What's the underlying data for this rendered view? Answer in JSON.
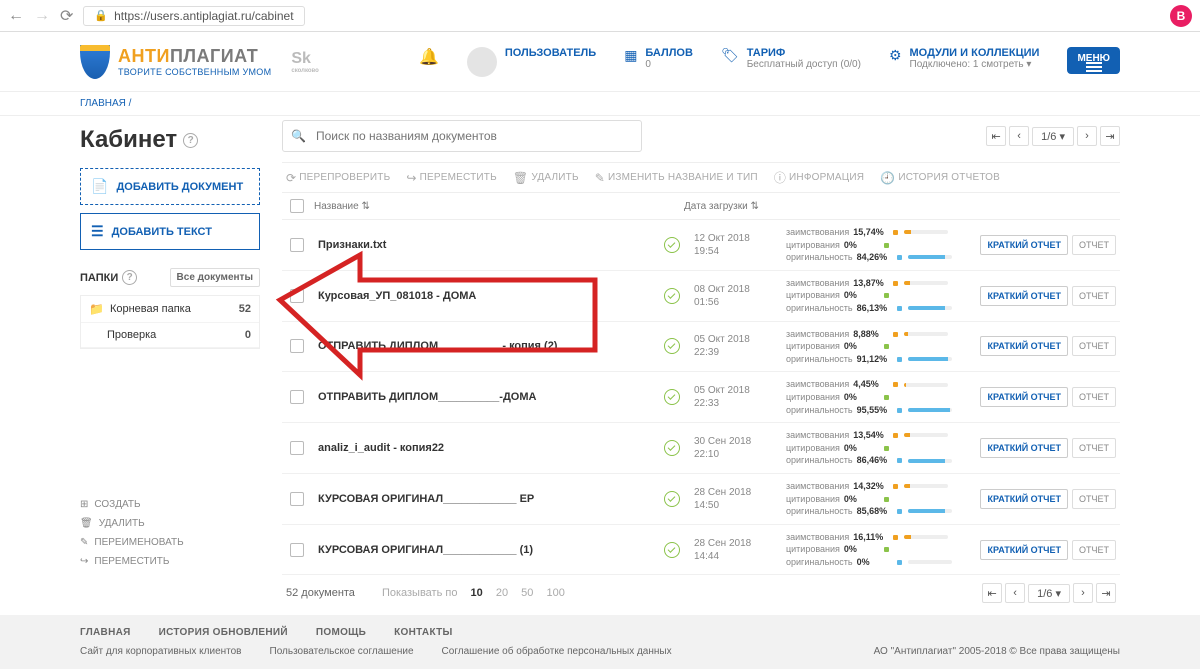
{
  "browser": {
    "url": "https://users.antiplagiat.ru/cabinet",
    "user_initial": "B"
  },
  "header": {
    "logo_anti": "АНТИ",
    "logo_plag": "ПЛАГИАТ",
    "logo_sub": "ТВОРИТЕ СОБСТВЕННЫМ УМОМ",
    "sk": "Sk",
    "sk_sub": "сколково",
    "user_label": "ПОЛЬЗОВАТЕЛЬ",
    "ballov_label": "БАЛЛОВ",
    "ballov_value": "0",
    "tarif_label": "ТАРИФ",
    "tarif_value": "Бесплатный доступ (0/0)",
    "modules_label": "МОДУЛИ И КОЛЛЕКЦИИ",
    "modules_value": "Подключено: 1 смотреть ▾",
    "menu_label": "МЕНЮ"
  },
  "crumb": "ГЛАВНАЯ /",
  "sidebar": {
    "title": "Кабинет",
    "add_doc": "ДОБАВИТЬ ДОКУМЕНТ",
    "add_text": "ДОБАВИТЬ ТЕКСТ",
    "folders_label": "ПАПКИ",
    "all_docs": "Все документы",
    "root": {
      "label": "Корневая папка",
      "count": "52"
    },
    "child": {
      "label": "Проверка",
      "count": "0"
    },
    "actions": {
      "create": "СОЗДАТЬ",
      "delete": "УДАЛИТЬ",
      "rename": "ПЕРЕИМЕНОВАТЬ",
      "move": "ПЕРЕМЕСТИТЬ"
    }
  },
  "search": {
    "placeholder": "Поиск по названиям документов"
  },
  "pager": {
    "pos": "1/6 ▾"
  },
  "toolbar": {
    "recheck": "ПЕРЕПРОВЕРИТЬ",
    "move": "ПЕРЕМЕСТИТЬ",
    "delete": "УДАЛИТЬ",
    "rename": "ИЗМЕНИТЬ НАЗВАНИЕ И ТИП",
    "info": "ИНФОРМАЦИЯ",
    "history": "ИСТОРИЯ ОТЧЕТОВ"
  },
  "columns": {
    "name": "Название ⇅",
    "date": "Дата загрузки ⇅"
  },
  "metrics_labels": {
    "borrow": "заимствования",
    "cite": "цитирования",
    "orig": "оригинальность"
  },
  "row_actions": {
    "short": "КРАТКИЙ ОТЧЕТ",
    "full": "ОТЧЕТ"
  },
  "rows": [
    {
      "name": "Признаки.txt",
      "date1": "12 Окт 2018",
      "date2": "19:54",
      "borrow": "15,74%",
      "cite": "0%",
      "orig": "84,26%",
      "bw": 16,
      "ow": 84
    },
    {
      "name": "Курсовая_УП_081018 - ДОМА",
      "date1": "08 Окт 2018",
      "date2": "01:56",
      "borrow": "13,87%",
      "cite": "0%",
      "orig": "86,13%",
      "bw": 14,
      "ow": 86
    },
    {
      "name": "ОТПРАВИТЬ ДИПЛОМ__________ - копия (2)",
      "date1": "05 Окт 2018",
      "date2": "22:39",
      "borrow": "8,88%",
      "cite": "0%",
      "orig": "91,12%",
      "bw": 9,
      "ow": 91
    },
    {
      "name": "ОТПРАВИТЬ ДИПЛОМ__________-ДОМА",
      "date1": "05 Окт 2018",
      "date2": "22:33",
      "borrow": "4,45%",
      "cite": "0%",
      "orig": "95,55%",
      "bw": 4,
      "ow": 96
    },
    {
      "name": "analiz_i_audit - копия22",
      "date1": "30 Сен 2018",
      "date2": "22:10",
      "borrow": "13,54%",
      "cite": "0%",
      "orig": "86,46%",
      "bw": 14,
      "ow": 86
    },
    {
      "name": "КУРСОВАЯ ОРИГИНАЛ____________ ЕР",
      "date1": "28 Сен 2018",
      "date2": "14:50",
      "borrow": "14,32%",
      "cite": "0%",
      "orig": "85,68%",
      "bw": 14,
      "ow": 86
    },
    {
      "name": "КУРСОВАЯ ОРИГИНАЛ____________ (1)",
      "date1": "28 Сен 2018",
      "date2": "14:44",
      "borrow": "16,11%",
      "cite": "0%",
      "orig": "0%",
      "bw": 16,
      "ow": 0
    }
  ],
  "footer": {
    "total": "52 документа",
    "perpage_label": "Показывать по",
    "pp": [
      "10",
      "20",
      "50",
      "100"
    ]
  },
  "global_footer": {
    "top": [
      "ГЛАВНАЯ",
      "ИСТОРИЯ ОБНОВЛЕНИЙ",
      "ПОМОЩЬ",
      "КОНТАКТЫ"
    ],
    "bottom": [
      "Сайт для корпоративных клиентов",
      "Пользовательское соглашение",
      "Соглашение об обработке персональных данных"
    ],
    "copy": "АО \"Антиплагиат\" 2005-2018 © Все права защищены"
  }
}
